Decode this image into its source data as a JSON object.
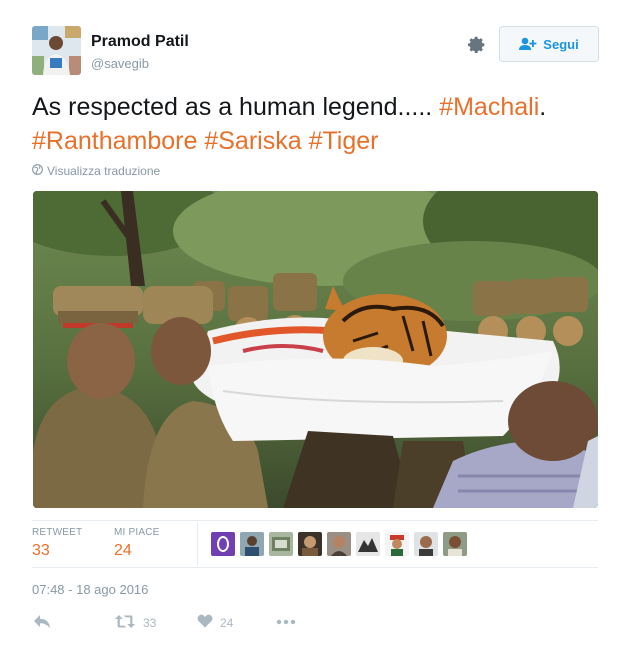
{
  "author": {
    "name": "Pramod Patil",
    "handle": "@savegib"
  },
  "follow_button": {
    "label": "Segui",
    "icon": "add-user-icon"
  },
  "settings_icon": "gear-icon",
  "tweet": {
    "text_plain": "As respected as a human legend..... ",
    "hashtags": [
      "#Machali",
      "#Ranthambore",
      "#Sariska",
      "#Tiger"
    ],
    "period": ".",
    "translate_label": "Visualizza traduzione"
  },
  "stats": {
    "retweet_label": "RETWEET",
    "retweet_count": "33",
    "likes_label": "MI PIACE",
    "likes_count": "24",
    "liker_avatars_count": 9
  },
  "timestamp": "07:48 - 18 ago 2016",
  "actions": {
    "reply_icon": "reply-icon",
    "retweet_icon": "retweet-icon",
    "retweet_count": "33",
    "like_icon": "heart-icon",
    "like_count": "24",
    "more_icon": "more-dots-icon"
  },
  "colors": {
    "hashtag": "#e8702a",
    "link_blue": "#1b95e0",
    "muted": "#8899a6",
    "icon_grey": "#aab8c2"
  }
}
